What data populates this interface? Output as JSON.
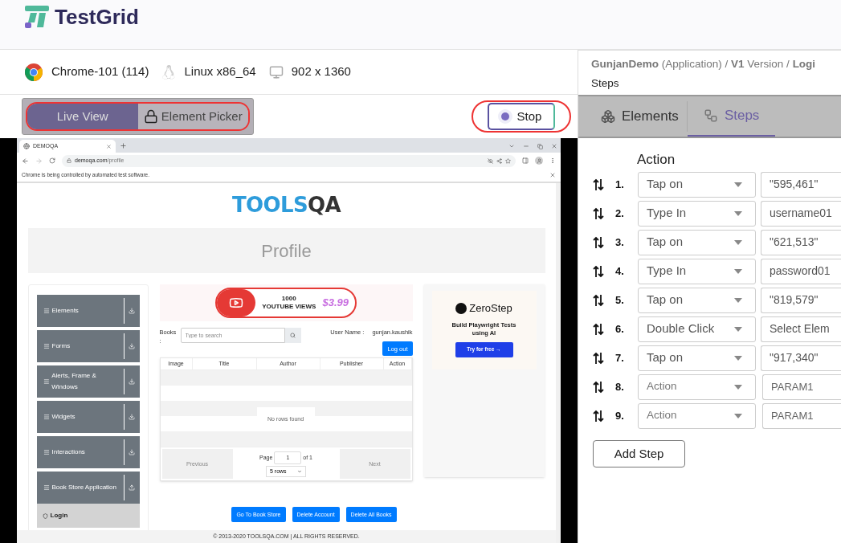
{
  "app": {
    "logo": "TestGrid"
  },
  "env": {
    "browser": "Chrome-101 (114)",
    "os": "Linux x86_64",
    "resolution": "902 x 1360"
  },
  "view_toggle": [
    {
      "label": "Live View",
      "selected": true
    },
    {
      "label": "Element Picker",
      "selected": false,
      "locked": true
    }
  ],
  "stop_button": {
    "label": "Stop"
  },
  "breadcrumb": "**GunjanDemo** (Application) / **V1** Version / **Logi**",
  "breadcrumb_line2": "Steps",
  "panel_tabs": [
    {
      "label": "Elements",
      "kind": "elements",
      "selected": false
    },
    {
      "label": "Steps",
      "kind": "steps",
      "selected": true
    }
  ],
  "steps": {
    "column_heading": "Action",
    "rows": [
      {
        "number": "1.",
        "action": "Tap on",
        "value": "\"595,461\""
      },
      {
        "number": "2.",
        "action": "Type In",
        "value": "username01"
      },
      {
        "number": "3.",
        "action": "Tap on",
        "value": "\"621,513\""
      },
      {
        "number": "4.",
        "action": "Type In",
        "value": "password01"
      },
      {
        "number": "5.",
        "action": "Tap on",
        "value": "\"819,579\""
      },
      {
        "number": "6.",
        "action": "Double Click",
        "value": "Select Elem"
      },
      {
        "number": "7.",
        "action": "Tap on",
        "value": "\"917,340\""
      },
      {
        "number": "8.",
        "action_placeholder": "Action",
        "value_placeholder": "PARAM1"
      },
      {
        "number": "9.",
        "action_placeholder": "Action",
        "value_placeholder": "PARAM1"
      }
    ]
  },
  "add_step": "Add Step",
  "browser": {
    "tab": "DEMOQA",
    "url_host": "demoqa.com",
    "url_path": "/profile",
    "infobar": "Chrome is being controlled by automated test software.",
    "page": {
      "logo_blue": "TOOLS",
      "logo_dark": "QA",
      "heading": "Profile",
      "sidebar": [
        {
          "label": "Elements",
          "expanded": false
        },
        {
          "label": "Forms",
          "expanded": false
        },
        {
          "label": "Alerts, Frame & Windows",
          "expanded": false
        },
        {
          "label": "Widgets",
          "expanded": false
        },
        {
          "label": "Interactions",
          "expanded": false
        },
        {
          "label": "Book Store Application",
          "expanded": true,
          "children": [
            {
              "label": "Login"
            }
          ]
        }
      ],
      "ad": {
        "count": "1000",
        "text": "YOUTUBE VIEWS",
        "price": "$3.99"
      },
      "books_label": "Books :",
      "search_placeholder": "Type to search",
      "user_label": "User Name :",
      "user_name": "gunjan.kaushik",
      "logout": "Log out",
      "columns": [
        "Image",
        "Title",
        "Author",
        "Publisher",
        "Action"
      ],
      "empty": "No rows found",
      "previous": "Previous",
      "page_label": "Page",
      "page_value": "1",
      "page_of": "of 1",
      "rows_select": "5 rows",
      "next": "Next",
      "promo": {
        "brand": "ZeroStep",
        "text": "Build Playwright Tests using AI",
        "button": "Try for free →"
      },
      "buttons": [
        "Go To Book Store",
        "Delete Account",
        "Delete All Books"
      ],
      "footer": "© 2013-2020 TOOLSQA.COM | ALL RIGHTS RESERVED."
    }
  }
}
